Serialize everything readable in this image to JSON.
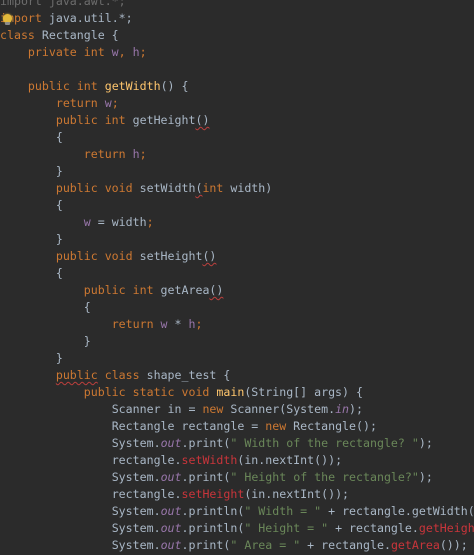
{
  "editor": {
    "lines": [
      [
        {
          "t": "import java.awt.*;",
          "c": "dim"
        }
      ],
      [
        {
          "t": "import",
          "c": "kw"
        },
        {
          "t": " java.util.*;",
          "c": "plain"
        }
      ],
      [
        {
          "t": "class",
          "c": "kw"
        },
        {
          "t": " Rectangle {",
          "c": "plain"
        }
      ],
      [
        {
          "t": "    "
        },
        {
          "t": "private int",
          "c": "kw"
        },
        {
          "t": " w",
          "c": "fld"
        },
        {
          "t": ", ",
          "c": "kw"
        },
        {
          "t": "h",
          "c": "fld"
        },
        {
          "t": ";",
          "c": "kw"
        }
      ],
      [],
      [
        {
          "t": "    "
        },
        {
          "t": "public int",
          "c": "kw"
        },
        {
          "t": " getWidth",
          "c": "fn"
        },
        {
          "t": "() {",
          "c": "plain"
        }
      ],
      [
        {
          "t": "        "
        },
        {
          "t": "return",
          "c": "kw"
        },
        {
          "t": " w",
          "c": "fld"
        },
        {
          "t": ";",
          "c": "kw"
        }
      ],
      [
        {
          "t": "        "
        },
        {
          "t": "public int",
          "c": "kw"
        },
        {
          "t": " getHeight",
          "c": "plain"
        },
        {
          "t": "()",
          "c": "plain",
          "sq": true
        }
      ],
      [
        {
          "t": "        {",
          "c": "plain"
        }
      ],
      [
        {
          "t": "            "
        },
        {
          "t": "return",
          "c": "kw"
        },
        {
          "t": " h",
          "c": "fld"
        },
        {
          "t": ";",
          "c": "kw"
        }
      ],
      [
        {
          "t": "        }",
          "c": "plain"
        }
      ],
      [
        {
          "t": "        "
        },
        {
          "t": "public void",
          "c": "kw"
        },
        {
          "t": " setWidth",
          "c": "plain"
        },
        {
          "t": "(",
          "c": "plain",
          "sq": true
        },
        {
          "t": "int",
          "c": "kw"
        },
        {
          "t": " width)",
          "c": "plain"
        }
      ],
      [
        {
          "t": "        {",
          "c": "plain"
        }
      ],
      [
        {
          "t": "            "
        },
        {
          "t": "w",
          "c": "fld"
        },
        {
          "t": " = width",
          "c": "plain"
        },
        {
          "t": ";",
          "c": "kw"
        }
      ],
      [
        {
          "t": "        }",
          "c": "plain"
        }
      ],
      [
        {
          "t": "        "
        },
        {
          "t": "public void",
          "c": "kw"
        },
        {
          "t": " setHeight",
          "c": "plain"
        },
        {
          "t": "()",
          "c": "plain",
          "sq": true
        }
      ],
      [
        {
          "t": "        {",
          "c": "plain"
        }
      ],
      [
        {
          "t": "            "
        },
        {
          "t": "public int",
          "c": "kw"
        },
        {
          "t": " getArea",
          "c": "plain"
        },
        {
          "t": "()",
          "c": "plain",
          "sq": true
        }
      ],
      [
        {
          "t": "            {",
          "c": "plain"
        }
      ],
      [
        {
          "t": "                "
        },
        {
          "t": "return",
          "c": "kw"
        },
        {
          "t": " w",
          "c": "fld"
        },
        {
          "t": " * ",
          "c": "plain"
        },
        {
          "t": "h",
          "c": "fld"
        },
        {
          "t": ";",
          "c": "kw"
        }
      ],
      [
        {
          "t": "            }",
          "c": "plain"
        }
      ],
      [
        {
          "t": "        }",
          "c": "plain"
        }
      ],
      [
        {
          "t": "        "
        },
        {
          "t": "public",
          "c": "kw",
          "sq": true
        },
        {
          "t": " class",
          "c": "kw"
        },
        {
          "t": " shape_test {",
          "c": "plain"
        }
      ],
      [
        {
          "t": "            "
        },
        {
          "t": "public static void",
          "c": "kw"
        },
        {
          "t": " main",
          "c": "fn"
        },
        {
          "t": "(String[] args) {",
          "c": "plain"
        }
      ],
      [
        {
          "t": "                "
        },
        {
          "t": "Scanner in = ",
          "c": "plain"
        },
        {
          "t": "new",
          "c": "kw"
        },
        {
          "t": " Scanner(System.",
          "c": "plain"
        },
        {
          "t": "in",
          "c": "stat"
        },
        {
          "t": ");",
          "c": "plain"
        }
      ],
      [
        {
          "t": "                "
        },
        {
          "t": "Rectangle rectangle = ",
          "c": "plain"
        },
        {
          "t": "new",
          "c": "kw"
        },
        {
          "t": " Rectangle();",
          "c": "plain"
        }
      ],
      [
        {
          "t": "                "
        },
        {
          "t": "System.",
          "c": "plain"
        },
        {
          "t": "out",
          "c": "stat"
        },
        {
          "t": ".print(",
          "c": "plain"
        },
        {
          "t": "\" Width of the rectangle? \"",
          "c": "str"
        },
        {
          "t": ");",
          "c": "plain"
        }
      ],
      [
        {
          "t": "                "
        },
        {
          "t": "rectangle.",
          "c": "plain"
        },
        {
          "t": "setWidth",
          "c": "err"
        },
        {
          "t": "(in.nextInt());",
          "c": "plain"
        }
      ],
      [
        {
          "t": "                "
        },
        {
          "t": "System.",
          "c": "plain"
        },
        {
          "t": "out",
          "c": "stat"
        },
        {
          "t": ".print(",
          "c": "plain"
        },
        {
          "t": "\" Height of the rectangle?\"",
          "c": "str"
        },
        {
          "t": ");",
          "c": "plain"
        }
      ],
      [
        {
          "t": "                "
        },
        {
          "t": "rectangle.",
          "c": "plain"
        },
        {
          "t": "setHeight",
          "c": "err"
        },
        {
          "t": "(in.nextInt());",
          "c": "plain"
        }
      ],
      [
        {
          "t": "                "
        },
        {
          "t": "System.",
          "c": "plain"
        },
        {
          "t": "out",
          "c": "stat"
        },
        {
          "t": ".println(",
          "c": "plain"
        },
        {
          "t": "\" Width = \"",
          "c": "str"
        },
        {
          "t": " + rectangle.getWidth());",
          "c": "plain"
        }
      ],
      [
        {
          "t": "                "
        },
        {
          "t": "System.",
          "c": "plain"
        },
        {
          "t": "out",
          "c": "stat"
        },
        {
          "t": ".println(",
          "c": "plain"
        },
        {
          "t": "\" Height = \"",
          "c": "str"
        },
        {
          "t": " + rectangle.",
          "c": "plain"
        },
        {
          "t": "getHeight",
          "c": "err"
        },
        {
          "t": "());",
          "c": "plain"
        }
      ],
      [
        {
          "t": "                "
        },
        {
          "t": "System.",
          "c": "plain"
        },
        {
          "t": "out",
          "c": "stat"
        },
        {
          "t": ".print(",
          "c": "plain"
        },
        {
          "t": "\" Area = \"",
          "c": "str"
        },
        {
          "t": " + rectangle.",
          "c": "plain"
        },
        {
          "t": "getArea",
          "c": "err"
        },
        {
          "t": "());",
          "c": "plain"
        }
      ]
    ],
    "gutter_icon": "intention-bulb-icon"
  }
}
